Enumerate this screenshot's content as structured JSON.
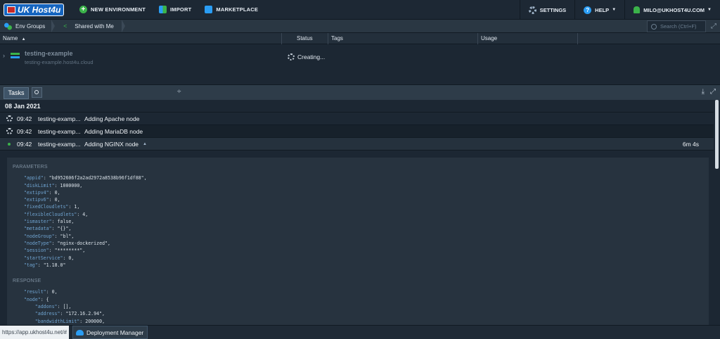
{
  "topbar": {
    "logo_text": "UK Host4u",
    "new_environment": "NEW ENVIRONMENT",
    "import": "IMPORT",
    "marketplace": "MARKETPLACE",
    "settings": "SETTINGS",
    "help": "HELP",
    "user": "MILO@UKHOST4U.COM"
  },
  "envbar": {
    "tabs": [
      {
        "label": "Env Groups",
        "icon": "env-groups-icon"
      },
      {
        "label": "Shared with Me",
        "icon": "share-icon"
      }
    ],
    "search_placeholder": "Search (Ctrl+F)"
  },
  "grid": {
    "columns": [
      "Name",
      "Status",
      "Tags",
      "Usage"
    ],
    "sort_indicator": "▲"
  },
  "environment": {
    "name": "testing-example",
    "domain": "testing-example.host4u.cloud",
    "status": "Creating..."
  },
  "tasks": {
    "tab_label": "Tasks",
    "date": "08 Jan 2021",
    "rows": [
      {
        "time": "09:42",
        "env": "testing-examp...",
        "message": "Adding Apache node",
        "state": "running"
      },
      {
        "time": "09:42",
        "env": "testing-examp...",
        "message": "Adding MariaDB node",
        "state": "running"
      },
      {
        "time": "09:42",
        "env": "testing-examp...",
        "message": "Adding NGINX node",
        "state": "done",
        "duration": "6m 4s"
      }
    ],
    "parameters_title": "PARAMETERS",
    "parameters": [
      [
        "\"appid\"",
        "\"bd952606f2a2ad2972a8538b96f1df88\","
      ],
      [
        "\"diskLimit\"",
        "1000000,"
      ],
      [
        "\"extipv4\"",
        "0,"
      ],
      [
        "\"extipv6\"",
        "0,"
      ],
      [
        "\"fixedCloudlets\"",
        "1,"
      ],
      [
        "\"flexibleCloudlets\"",
        "4,"
      ],
      [
        "\"ismaster\"",
        "false,"
      ],
      [
        "\"metadata\"",
        "\"{}\","
      ],
      [
        "\"nodeGroup\"",
        "\"bl\","
      ],
      [
        "\"nodeType\"",
        "\"nginx-dockerized\","
      ],
      [
        "\"session\"",
        "\"********\","
      ],
      [
        "\"startService\"",
        "0,"
      ],
      [
        "\"tag\"",
        "\"1.18.0\""
      ]
    ],
    "response_title": "RESPONSE",
    "response": [
      [
        "    ",
        "\"result\"",
        "0,"
      ],
      [
        "    ",
        "\"node\"",
        "{"
      ],
      [
        "        ",
        "\"addons\"",
        "[],"
      ],
      [
        "        ",
        "\"address\"",
        "\"172.16.2.94\","
      ],
      [
        "        ",
        "\"bandwidthLimit\"",
        "200000,"
      ]
    ]
  },
  "footer": {
    "url_hint": "https://app.ukhost4u.net/#",
    "deployment_manager": "Deployment Manager"
  }
}
